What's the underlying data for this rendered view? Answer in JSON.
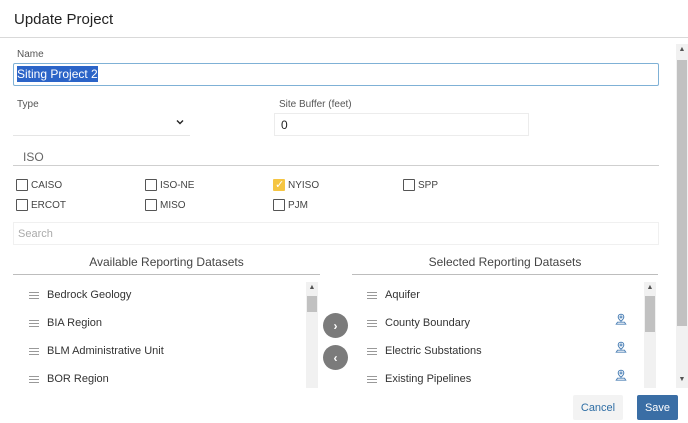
{
  "dialog": {
    "title": "Update Project"
  },
  "form": {
    "name_label": "Name",
    "name_value": "Siting Project 2",
    "type_label": "Type",
    "type_value": "",
    "buffer_label": "Site Buffer (feet)",
    "buffer_value": "0"
  },
  "iso": {
    "heading": "ISO",
    "options": [
      {
        "label": "CAISO",
        "checked": false
      },
      {
        "label": "ISO-NE",
        "checked": false
      },
      {
        "label": "NYISO",
        "checked": true
      },
      {
        "label": "SPP",
        "checked": false
      },
      {
        "label": "ERCOT",
        "checked": false
      },
      {
        "label": "MISO",
        "checked": false
      },
      {
        "label": "PJM",
        "checked": false
      }
    ]
  },
  "search": {
    "placeholder": "Search"
  },
  "available": {
    "heading": "Available Reporting Datasets",
    "items": [
      "Bedrock Geology",
      "BIA Region",
      "BLM Administrative Unit",
      "BOR Region"
    ]
  },
  "selected": {
    "heading": "Selected Reporting Datasets",
    "items": [
      {
        "label": "Aquifer",
        "has_map_icon": false
      },
      {
        "label": "County Boundary",
        "has_map_icon": true
      },
      {
        "label": "Electric Substations",
        "has_map_icon": true
      },
      {
        "label": "Existing Pipelines",
        "has_map_icon": true
      }
    ]
  },
  "actions": {
    "cancel": "Cancel",
    "save": "Save"
  },
  "colors": {
    "accent": "#3a6ea5",
    "checked": "#f5c542",
    "move_button": "#7b7b7b"
  },
  "icons": {
    "move_right": "chevron-right-icon",
    "move_left": "chevron-left-icon",
    "drag": "drag-handle-icon",
    "map": "map-pin-icon",
    "dropdown": "chevron-down-icon"
  }
}
